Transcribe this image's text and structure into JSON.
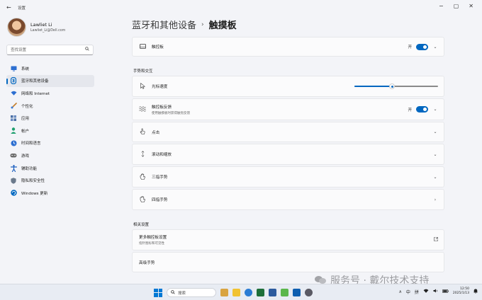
{
  "window": {
    "title": "设置",
    "back_glyph": "←",
    "controls": {
      "minimize": "−",
      "maximize": "▢",
      "close": "✕"
    }
  },
  "profile": {
    "name": "Lawliet Li",
    "email": "Lawliet_Li@Dell.com"
  },
  "search": {
    "placeholder": "查找设置"
  },
  "nav": {
    "items": [
      {
        "label": "系统",
        "icon": "monitor-icon",
        "color": "#2d6fd1"
      },
      {
        "label": "蓝牙和其他设备",
        "icon": "bluetooth-icon",
        "color": "#0067c0",
        "active": true
      },
      {
        "label": "网络和 Internet",
        "icon": "wifi-icon",
        "color": "#2d6fd1"
      },
      {
        "label": "个性化",
        "icon": "brush-icon",
        "color": "#c57d2a"
      },
      {
        "label": "应用",
        "icon": "apps-icon",
        "color": "#4a6fa5"
      },
      {
        "label": "帐户",
        "icon": "account-icon",
        "color": "#1e9f6e"
      },
      {
        "label": "时间和语言",
        "icon": "globe-clock-icon",
        "color": "#2d6fd1"
      },
      {
        "label": "游戏",
        "icon": "gamepad-icon",
        "color": "#6b6b6b"
      },
      {
        "label": "辅助功能",
        "icon": "accessibility-icon",
        "color": "#1d5fbf"
      },
      {
        "label": "隐私和安全性",
        "icon": "shield-icon",
        "color": "#6b7a8c"
      },
      {
        "label": "Windows 更新",
        "icon": "update-icon",
        "color": "#0067c0"
      }
    ]
  },
  "breadcrumb": {
    "parent": "蓝牙和其他设备",
    "separator": "›",
    "current": "触摸板"
  },
  "touchpad": {
    "title": "触控板",
    "toggle_label": "开"
  },
  "gestures_section": {
    "label": "手势和交互"
  },
  "cursor_speed": {
    "title": "光标速度",
    "value": 0.45
  },
  "feedback": {
    "title": "触控板反馈",
    "subtitle": "使用触摸板时获得触觉反馈",
    "toggle_label": "开"
  },
  "rows": [
    {
      "title": "点击",
      "icon": "tap-icon"
    },
    {
      "title": "滚动和缩放",
      "icon": "scroll-icon"
    },
    {
      "title": "三指手势",
      "icon": "three-finger-icon"
    },
    {
      "title": "四指手势",
      "icon": "four-finger-icon"
    }
  ],
  "related_section": {
    "label": "相关设置"
  },
  "more_settings": {
    "title": "更多触控板设置",
    "subtitle": "指针图标和可见性"
  },
  "advanced": {
    "title": "高级手势"
  },
  "watermark": {
    "text": "服务号 · 戴尔技术支持"
  },
  "taskbar": {
    "search_label": "搜索",
    "tray": {
      "expand": "∧",
      "ime1": "中",
      "ime2": "拼",
      "wifi": "WiFi",
      "volume": "音",
      "battery": "电"
    },
    "time": "12:50",
    "date": "2025/1/13"
  }
}
